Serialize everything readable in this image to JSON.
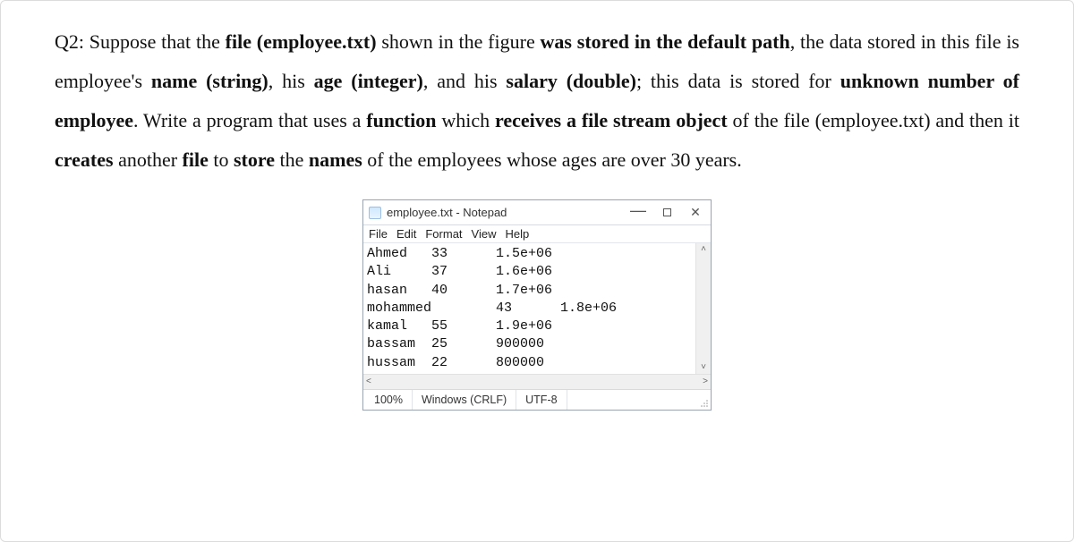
{
  "question": {
    "prefix": "Q2: Suppose that the ",
    "p1b1": "file (employee.txt)",
    "p1t1": " shown in the figure ",
    "p1b2": "was stored in the default path",
    "p1t2": ", the data stored in this file is employee's ",
    "p1b3": "name",
    "p1t3": " ",
    "p1b4": "(string)",
    "p1t4": ", his ",
    "p1b5": "age",
    "p1t5": " ",
    "p1b6": "(integer)",
    "p1t6": ", and his ",
    "p1b7": "salary",
    "p1t7": " ",
    "p1b8": "(double)",
    "p1t8": "; this data is stored for ",
    "p1b9": "unknown number of employee",
    "p1t9": ". Write a program that uses a ",
    "p1b10": "function",
    "p1t10": " which ",
    "p1b11": "receives a file stream object",
    "p1t11": " of the file (employee.txt) and then it ",
    "p1b12": "creates ",
    "p1t12": "another ",
    "p1b13": "file",
    "p1t13": " to ",
    "p1b14": "store",
    "p1t14": " the ",
    "p1b15": "names",
    "p1t15": " of the employees whose ages are over 30 years."
  },
  "notepad": {
    "title": "employee.txt - Notepad",
    "menu": {
      "file": "File",
      "edit": "Edit",
      "format": "Format",
      "view": "View",
      "help": "Help"
    },
    "lines": {
      "l1": "Ahmed   33      1.5e+06",
      "l2": "Ali     37      1.6e+06",
      "l3": "hasan   40      1.7e+06",
      "l4": "mohammed        43      1.8e+06",
      "l5": "kamal   55      1.9e+06",
      "l6": "bassam  25      900000",
      "l7": "hussam  22      800000"
    },
    "status": {
      "zoom": "100%",
      "eol": "Windows (CRLF)",
      "enc": "UTF-8"
    }
  }
}
